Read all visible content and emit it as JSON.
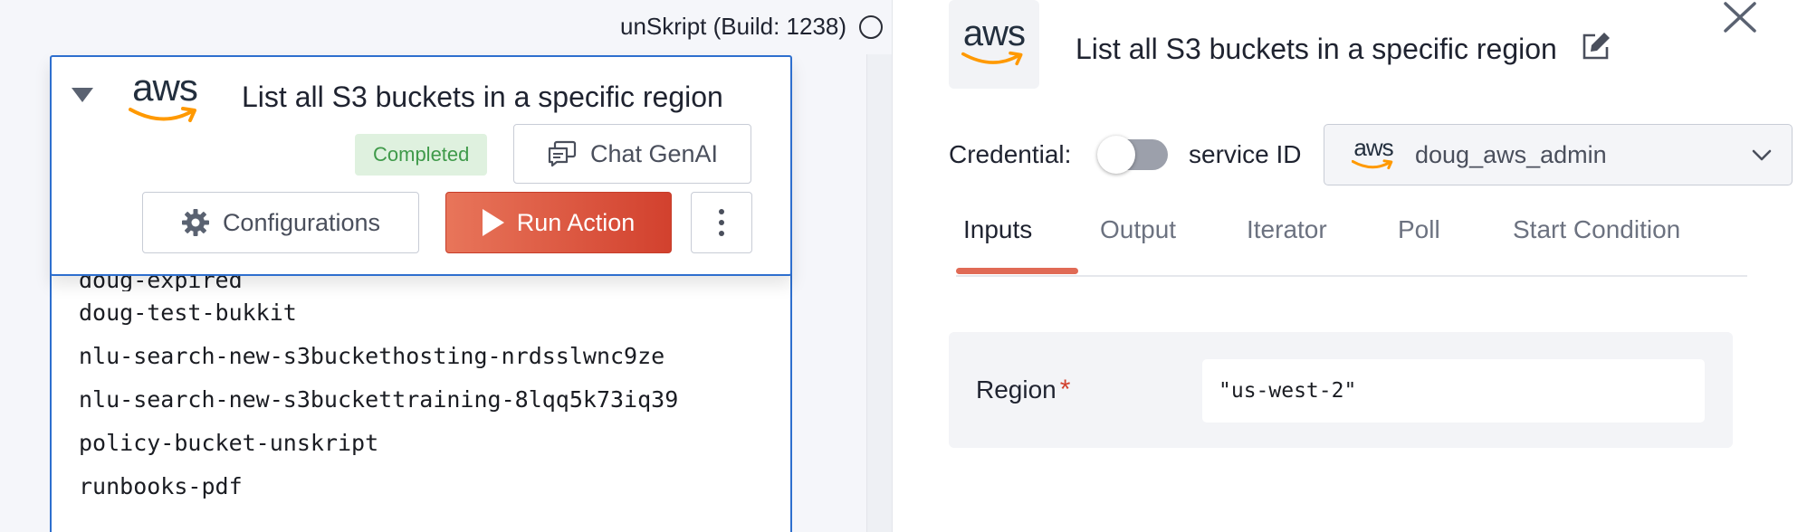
{
  "build": {
    "label": "unSkript (Build: 1238)"
  },
  "card": {
    "logo_text": "aws",
    "title": "List all S3 buckets in a specific region",
    "status": "Completed",
    "chat_label": "Chat GenAI",
    "config_label": "Configurations",
    "run_label": "Run Action"
  },
  "output": {
    "lines": [
      "doug-expired",
      "doug-test-bukkit",
      "nlu-search-new-s3buckethosting-nrdsslwnc9ze",
      "nlu-search-new-s3buckettraining-8lqq5k73iq39",
      "policy-bucket-unskript",
      "runbooks-pdf"
    ]
  },
  "panel": {
    "logo_text": "aws",
    "title": "List all S3 buckets in a specific region",
    "credential_label": "Credential:",
    "service_id_label": "service ID",
    "credential_toggle_on": false,
    "credential_logo_text": "aws",
    "credential_value": "doug_aws_admin",
    "tabs": [
      "Inputs",
      "Output",
      "Iterator",
      "Poll",
      "Start Condition"
    ],
    "active_tab": "Inputs",
    "region_label": "Region",
    "required_mark": "*",
    "region_value": "\"us-west-2\""
  },
  "colors": {
    "accent": "#e06a55",
    "run_gradient_start": "#e8755a",
    "run_gradient_end": "#d2412e",
    "aws_orange": "#ff9900",
    "selection_border": "#2e6fce",
    "status_green": "#3f9a4a"
  },
  "icons": [
    "collapse-triangle-icon",
    "aws-logo-icon",
    "chat-icon",
    "gear-icon",
    "play-icon",
    "more-vertical-icon",
    "edit-icon",
    "close-icon",
    "chevron-down-icon",
    "status-circle-icon"
  ]
}
